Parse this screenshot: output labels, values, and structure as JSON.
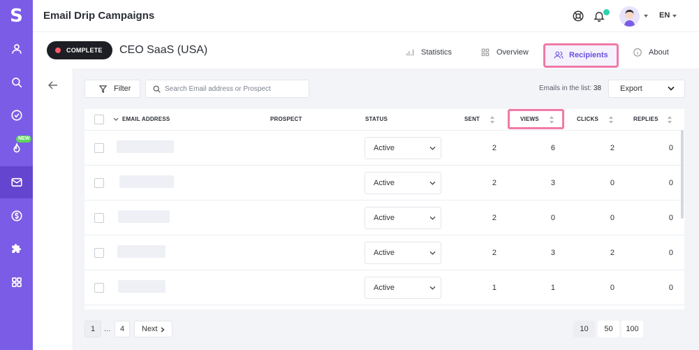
{
  "app": {
    "logo_letter": "S",
    "title": "Email Drip Campaigns",
    "language": "EN"
  },
  "sidebar": {
    "items": [
      {
        "name": "profile",
        "icon": "user-icon"
      },
      {
        "name": "search",
        "icon": "search-icon"
      },
      {
        "name": "tasks",
        "icon": "check-circle-icon"
      },
      {
        "name": "hot",
        "icon": "flame-icon",
        "badge": "NEW"
      },
      {
        "name": "email",
        "icon": "mail-icon",
        "active": true
      },
      {
        "name": "billing",
        "icon": "dollar-icon"
      },
      {
        "name": "integrations",
        "icon": "puzzle-icon"
      },
      {
        "name": "apps",
        "icon": "grid-icon"
      }
    ]
  },
  "campaign": {
    "status_label": "COMPLETE",
    "name": "CEO SaaS (USA)",
    "tabs": [
      {
        "label": "Statistics",
        "icon": "bar-chart-icon"
      },
      {
        "label": "Overview",
        "icon": "grid-icon"
      },
      {
        "label": "Recipients",
        "icon": "users-icon",
        "active": true
      },
      {
        "label": "About",
        "icon": "info-icon"
      }
    ]
  },
  "toolbar": {
    "filter_label": "Filter",
    "search_placeholder": "Search Email address or Prospect",
    "emails_label": "Emails in the list:",
    "emails_count": "38",
    "export_label": "Export"
  },
  "table": {
    "columns": [
      "EMAIL ADDRESS",
      "PROSPECT",
      "STATUS",
      "SENT",
      "VIEWS",
      "CLICKS",
      "REPLIES"
    ],
    "rows": [
      {
        "status": "Active",
        "sent": "2",
        "views": "6",
        "clicks": "2",
        "replies": "0"
      },
      {
        "status": "Active",
        "sent": "2",
        "views": "3",
        "clicks": "0",
        "replies": "0"
      },
      {
        "status": "Active",
        "sent": "2",
        "views": "0",
        "clicks": "0",
        "replies": "0"
      },
      {
        "status": "Active",
        "sent": "2",
        "views": "3",
        "clicks": "2",
        "replies": "0"
      },
      {
        "status": "Active",
        "sent": "1",
        "views": "1",
        "clicks": "0",
        "replies": "0"
      }
    ]
  },
  "pagination": {
    "current": "1",
    "dots": "...",
    "last": "4",
    "next_label": "Next",
    "page_sizes": [
      "10",
      "50",
      "100"
    ]
  },
  "colors": {
    "accent": "#7b5ce6",
    "highlight": "#f07aa6",
    "badge_new": "#5cd65c"
  }
}
